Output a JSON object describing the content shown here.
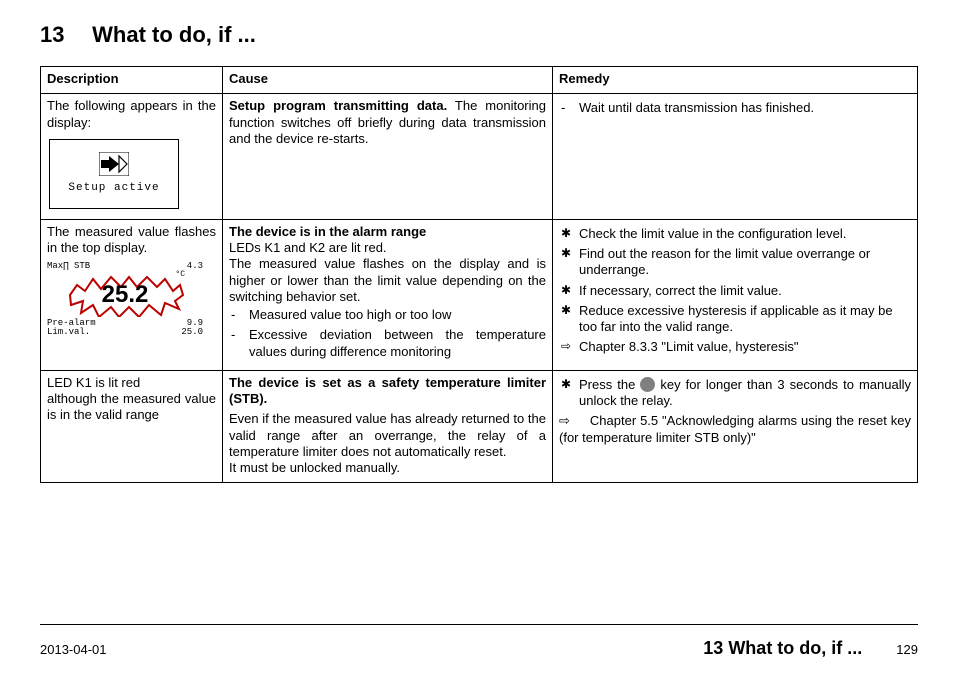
{
  "chapter_number": "13",
  "chapter_title": "What to do, if ...",
  "table": {
    "headers": {
      "desc": "Description",
      "cause": "Cause",
      "remedy": "Remedy"
    },
    "rows": [
      {
        "desc_text": "The following appears in the display:",
        "setup_label": "Setup active",
        "cause_bold": "Setup program transmitting data.",
        "cause_text": "The monitoring function switches off briefly during data transmission and the device re-starts.",
        "remedy_dash": [
          "Wait until data transmission has finished."
        ]
      },
      {
        "desc_text": "The measured value flashes in the top display.",
        "alarm": {
          "top_left": "Max∏ STB",
          "top_right": "4.3",
          "unit": "°C",
          "value": "25.2",
          "line1_left": "Pre-alarm",
          "line1_right": "9.9",
          "line2_left": "Lim.val.",
          "line2_right": "25.0"
        },
        "cause_bold": "The device is in the alarm range",
        "cause_text1": "LEDs K1 and K2 are lit red.",
        "cause_text2": "The measured value flashes on the display and is higher or lower than the limit value depending on the switching behavior set.",
        "cause_dash": [
          "Measured value too high or too low",
          "Excessive deviation between the temperature values during difference monitoring"
        ],
        "remedy_star": [
          "Check the limit value in the configuration level.",
          "Find out the reason for the limit value overrange or underrange.",
          "If necessary, correct the limit value.",
          "Reduce excessive hysteresis if applicable as it may be too far into the valid range."
        ],
        "remedy_arrow": "Chapter 8.3.3 \"Limit value, hysteresis\""
      },
      {
        "desc_text1": "LED K1 is lit red",
        "desc_text2": "although the measured value is in the valid range",
        "cause_bold": "The device is set as a safety temperature limiter (STB).",
        "cause_text1": "Even if the measured value has already returned to the valid range after an overrange, the relay of a temperature limiter does not automatically reset.",
        "cause_text2": "It must be unlocked manually.",
        "remedy_star_pre": "Press the ",
        "remedy_star_post": " key for longer than 3 seconds to manually unlock the relay.",
        "remedy_arrow": "Chapter 5.5 \"Acknowledging alarms using the reset key (for temperature limiter STB only)\""
      }
    ]
  },
  "footer": {
    "date": "2013-04-01",
    "title": "13 What to do, if ...",
    "page": "129"
  }
}
